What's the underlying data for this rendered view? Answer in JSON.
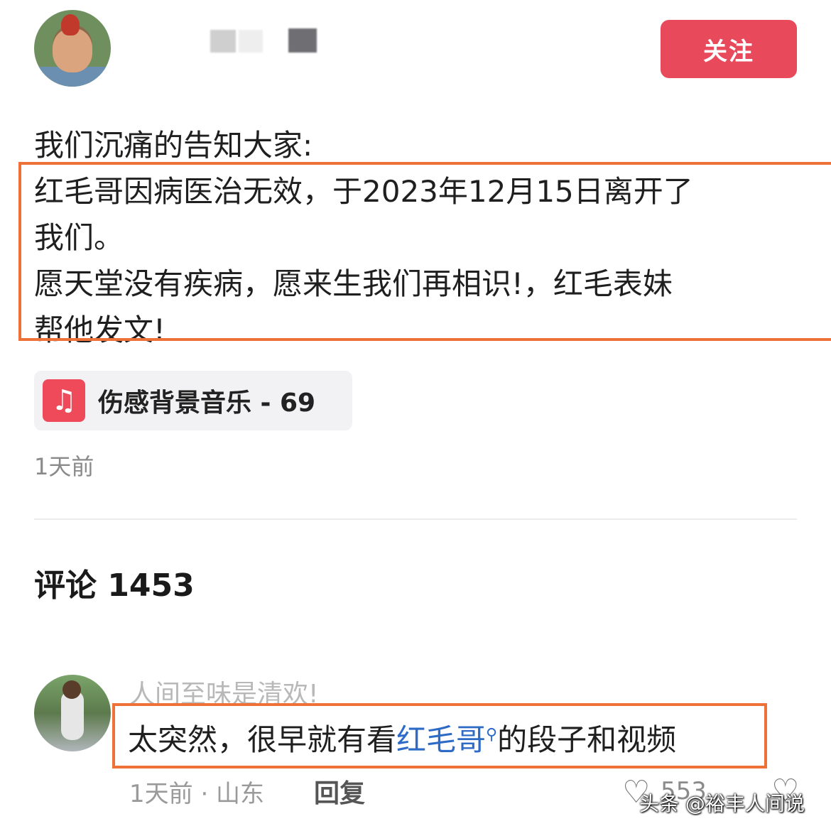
{
  "header": {
    "follow_label": "关注"
  },
  "post": {
    "lines": [
      "我们沉痛的告知大家:",
      "红毛哥因病医治无效，于2023年12月15日离开了",
      "我们。",
      "愿天堂没有疾病，愿来生我们再相识!，红毛表妹",
      "帮他发文!"
    ],
    "music": {
      "icon": "music-note-icon",
      "title": "伤感背景音乐 - 69"
    },
    "time": "1天前"
  },
  "comments": {
    "header": "评论 1453",
    "items": [
      {
        "name": "人间至味是清欢!",
        "text_before": "太突然，很早就有看",
        "keyword": "红毛哥",
        "text_after": "的段子和视频",
        "meta": "1天前 · 山东",
        "reply_label": "回复",
        "likes": "553"
      }
    ]
  },
  "watermark": "头条 @裕丰人间说",
  "colors": {
    "accent": "#e94a5b",
    "highlight_box": "#ee7137",
    "link": "#2e6bc6"
  }
}
